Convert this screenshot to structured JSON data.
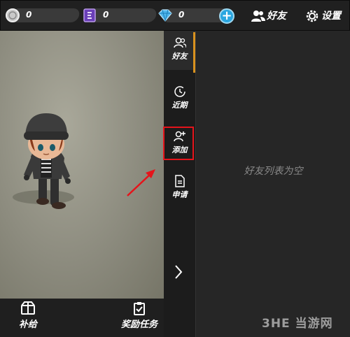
{
  "resources": [
    {
      "icon": "silver-coin-icon",
      "value": "0"
    },
    {
      "icon": "purple-ticket-icon",
      "value": "0"
    },
    {
      "icon": "blue-diamond-icon",
      "value": "0"
    }
  ],
  "top_buttons": {
    "friends_label": "好友",
    "settings_label": "设置"
  },
  "side_nav": [
    {
      "icon": "friends-icon",
      "label": "好友",
      "active": true
    },
    {
      "icon": "recent-clock-icon",
      "label": "近期"
    },
    {
      "icon": "add-friend-icon",
      "label": "添加"
    },
    {
      "icon": "document-icon",
      "label": "申请"
    }
  ],
  "bottom_buttons": {
    "supply_label": "补给",
    "reward_tasks_label": "奖励任务"
  },
  "friends_list": {
    "empty_text": "好友列表为空"
  },
  "watermark": "3HE 当游网",
  "colors": {
    "accent": "#d9921e",
    "highlight_box": "#e5141b",
    "plus_button": "#2aa6e0"
  }
}
